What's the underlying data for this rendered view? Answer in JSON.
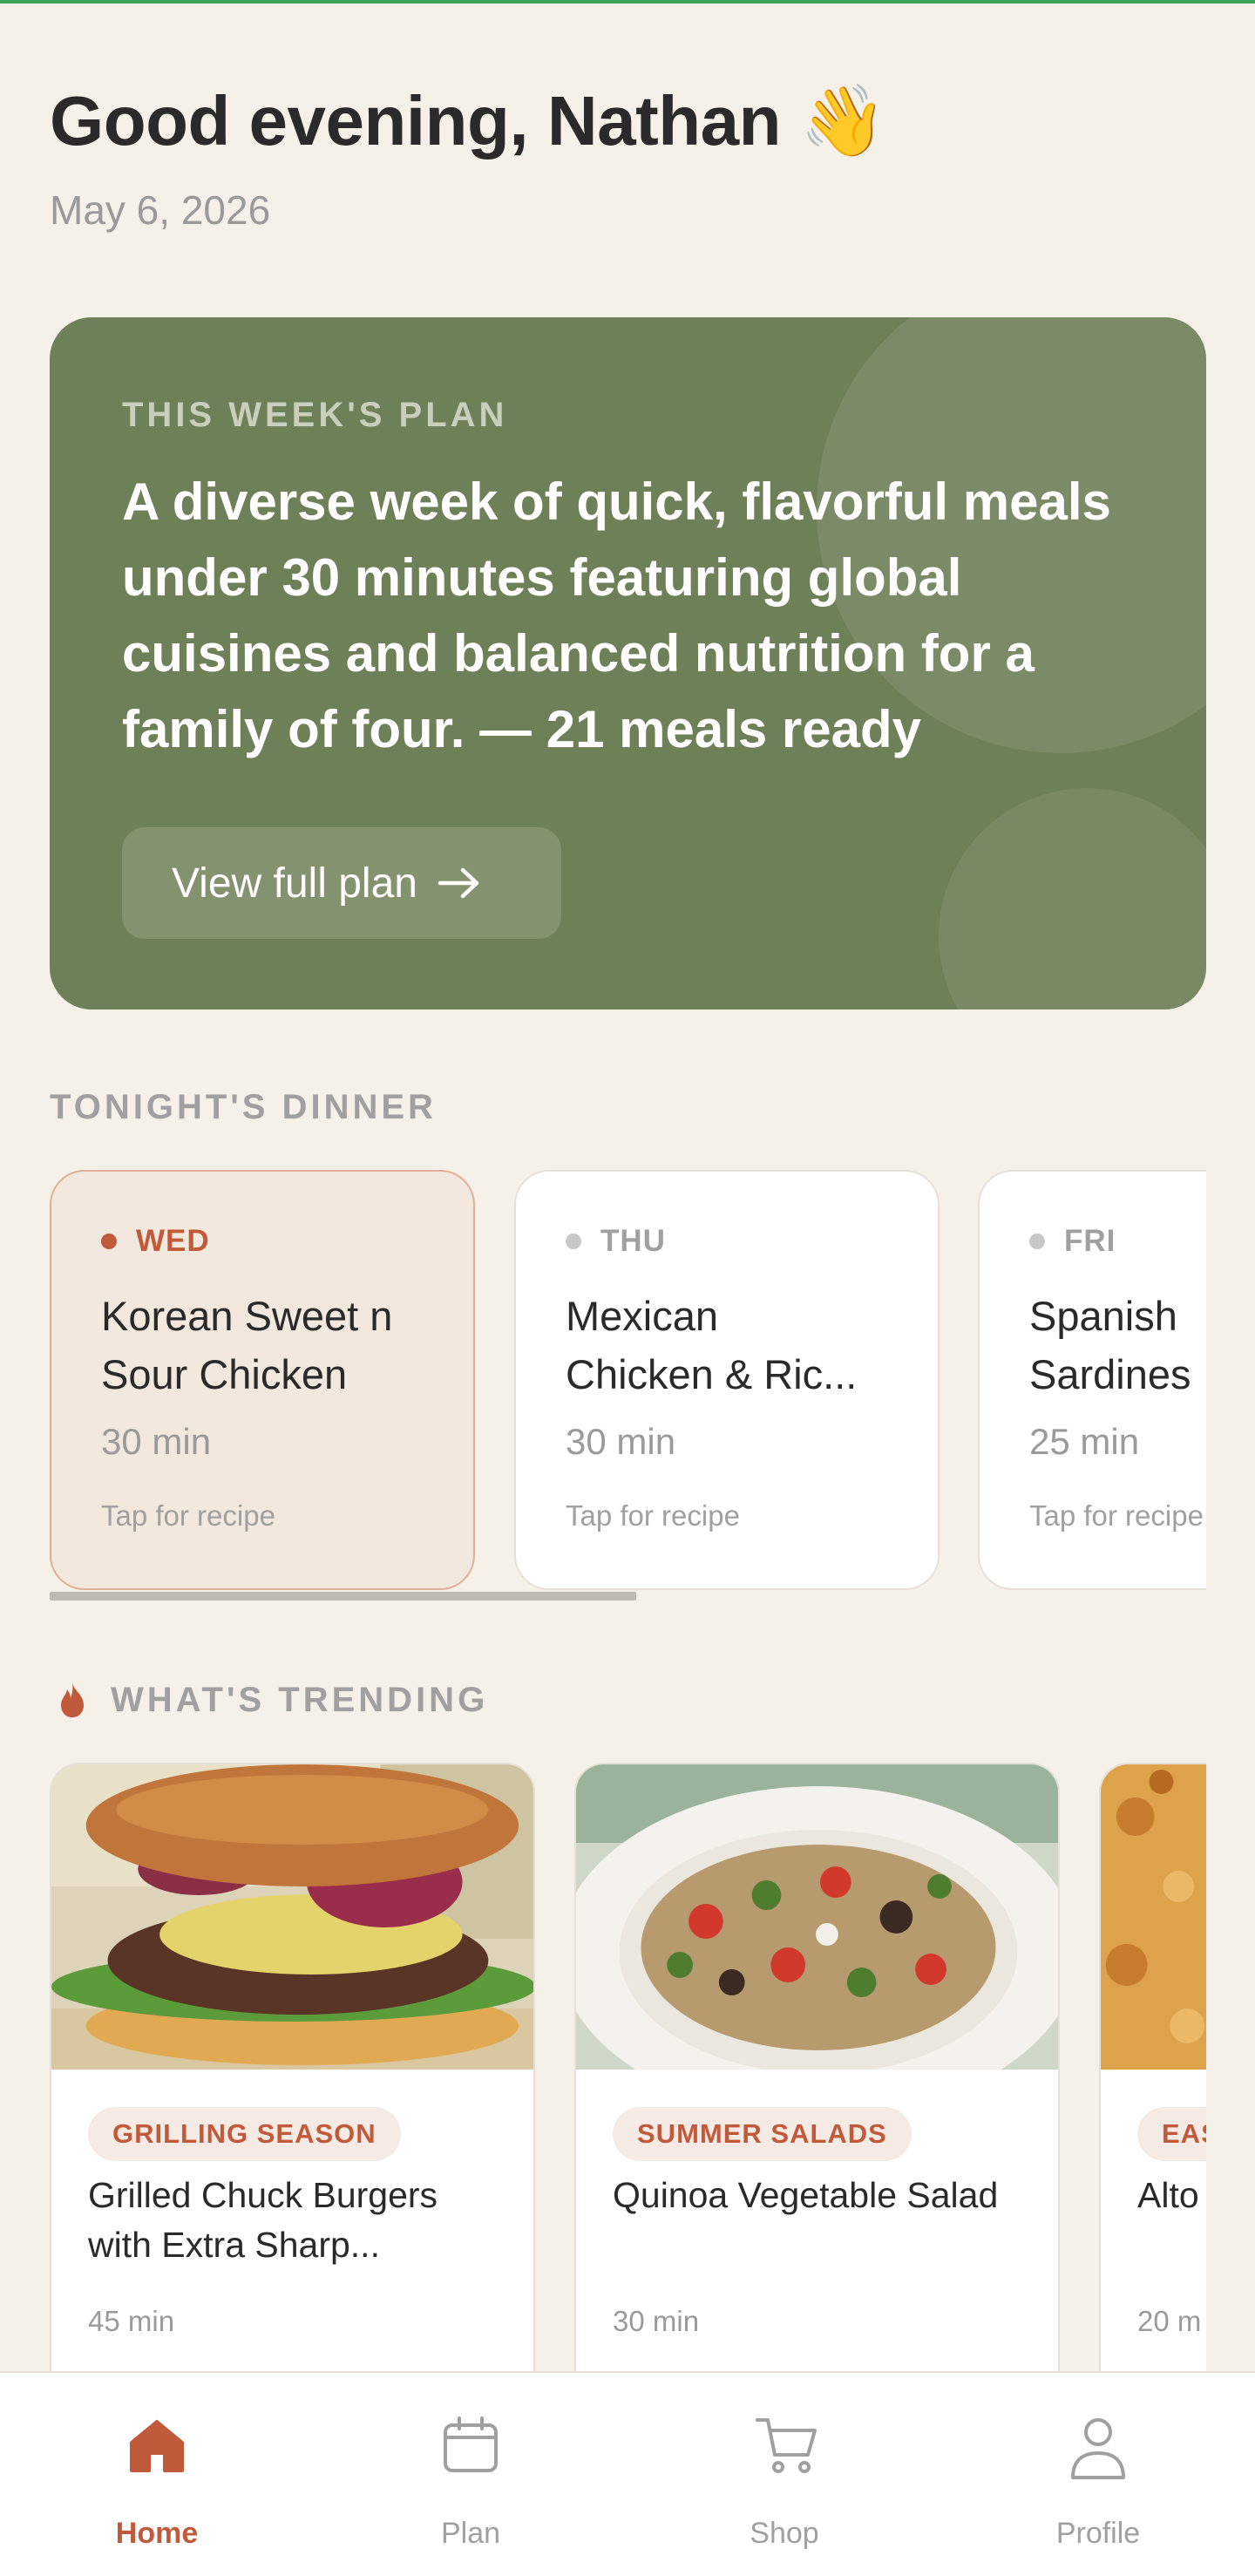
{
  "header": {
    "greeting": "Good evening, Nathan 👋",
    "date": "May 6, 2026"
  },
  "week_plan": {
    "eyebrow": "THIS WEEK'S PLAN",
    "description": "A diverse week of quick, flavorful meals under 30 minutes featuring global cuisines and balanced nutrition for a family of four. — 21 meals ready",
    "button_label": "View full plan"
  },
  "tonight": {
    "section_title": "TONIGHT'S DINNER",
    "days": [
      {
        "day": "WED",
        "name_line1": "Korean Sweet n",
        "name_line2": "Sour Chicken",
        "time": "30 min",
        "hint": "Tap for recipe",
        "active": true
      },
      {
        "day": "THU",
        "name_line1": "Mexican",
        "name_line2": "Chicken & Ric...",
        "time": "30 min",
        "hint": "Tap for recipe",
        "active": false
      },
      {
        "day": "FRI",
        "name_line1": "Spanish",
        "name_line2": "Sardines",
        "time": "25 min",
        "hint": "Tap for recipe",
        "active": false
      }
    ]
  },
  "trending": {
    "section_title": "WHAT'S TRENDING",
    "items": [
      {
        "tag": "GRILLING SEASON",
        "title": "Grilled Chuck Burgers with Extra Sharp...",
        "time": "45 min"
      },
      {
        "tag": "SUMMER SALADS",
        "title": "Quinoa Vegetable Salad",
        "time": "30 min"
      },
      {
        "tag": "EAS",
        "title": "Alto Mac",
        "time": "20 m"
      }
    ]
  },
  "nav": {
    "home": "Home",
    "plan": "Plan",
    "shop": "Shop",
    "profile": "Profile"
  },
  "colors": {
    "background": "#f5f0e8",
    "hero": "#6e8058",
    "accent": "#c05a3a",
    "top_bar": "#3aa55a"
  },
  "icons": [
    "arrow-right-icon",
    "flame-icon",
    "home-icon",
    "calendar-icon",
    "cart-icon",
    "user-icon"
  ]
}
